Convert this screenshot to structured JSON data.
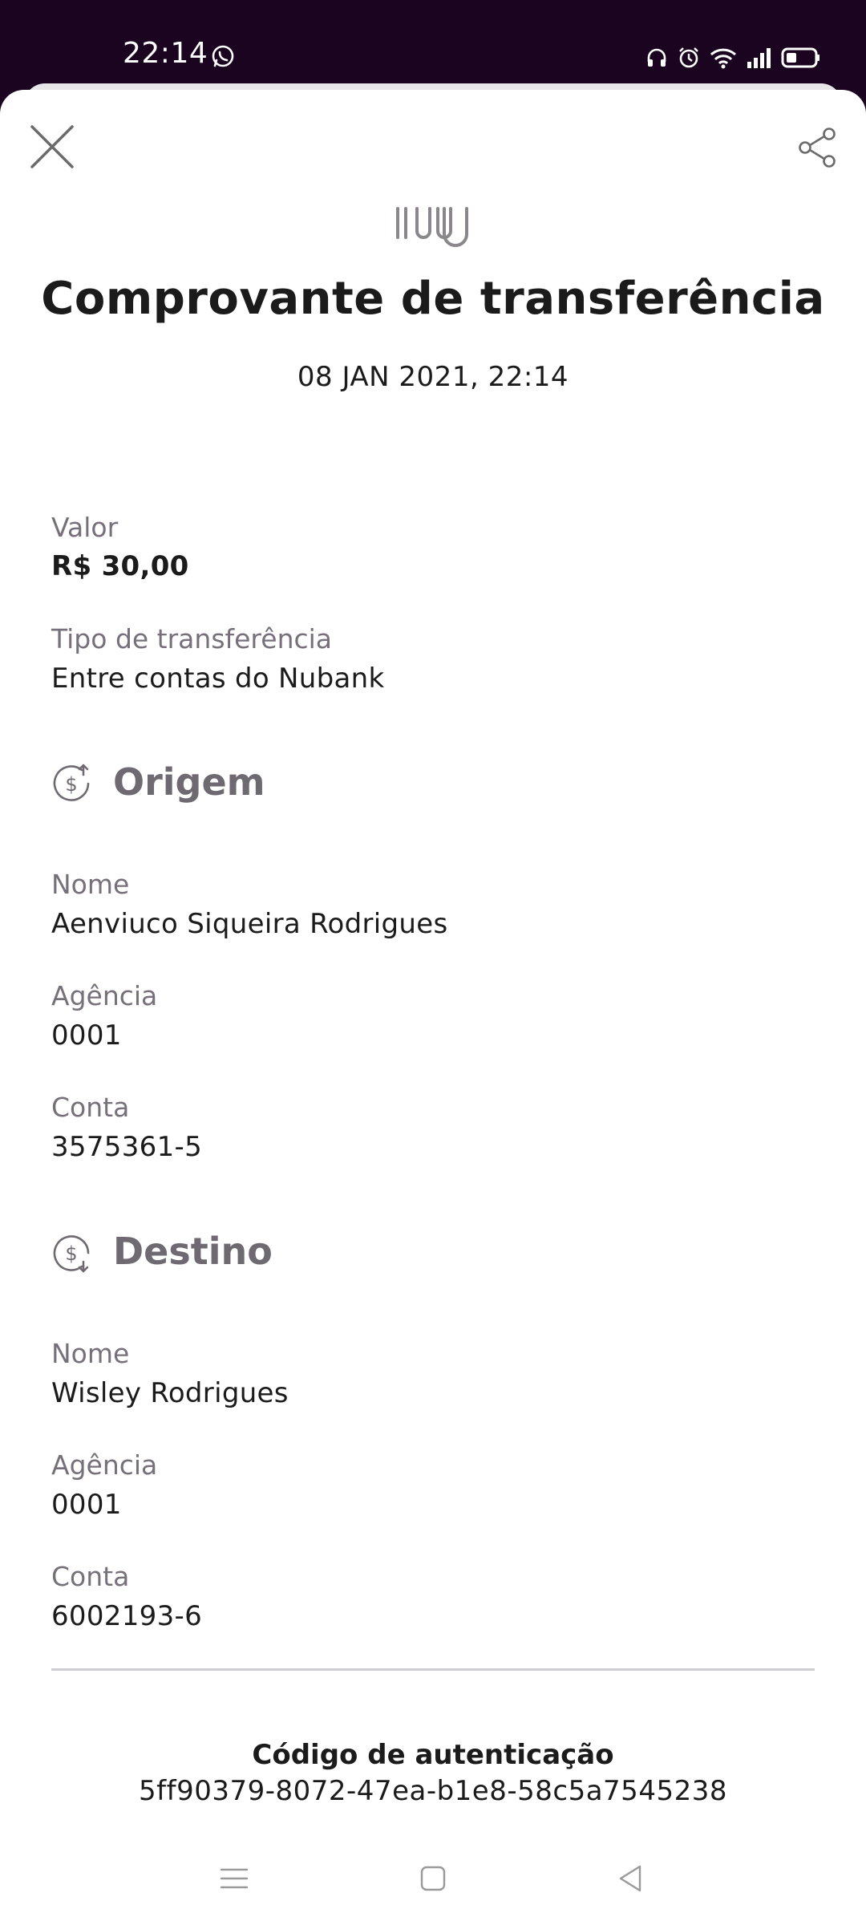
{
  "status_bar": {
    "time": "22:14"
  },
  "receipt": {
    "title": "Comprovante de transferência",
    "date": "08 JAN 2021, 22:14",
    "valor_label": "Valor",
    "valor": "R$ 30,00",
    "tipo_label": "Tipo de transferência",
    "tipo": "Entre contas do Nubank"
  },
  "origem": {
    "heading": "Origem",
    "nome_label": "Nome",
    "nome": "Aenviuco Siqueira Rodrigues",
    "agencia_label": "Agência",
    "agencia": "0001",
    "conta_label": "Conta",
    "conta": "3575361-5"
  },
  "destino": {
    "heading": "Destino",
    "nome_label": "Nome",
    "nome": "Wisley Rodrigues",
    "agencia_label": "Agência",
    "agencia": "0001",
    "conta_label": "Conta",
    "conta": "6002193-6"
  },
  "auth": {
    "label": "Código de autenticação",
    "code": "5ff90379-8072-47ea-b1e8-58c5a7545238"
  },
  "icons": {
    "close": "close-icon",
    "share": "share-icon",
    "logo": "nubank-logo",
    "origem": "money-out-icon",
    "destino": "money-in-icon"
  },
  "colors": {
    "status_bar": "#1a0420",
    "text": "#1b1b1b",
    "label": "#77707a",
    "section_heading": "#6f6a72"
  }
}
